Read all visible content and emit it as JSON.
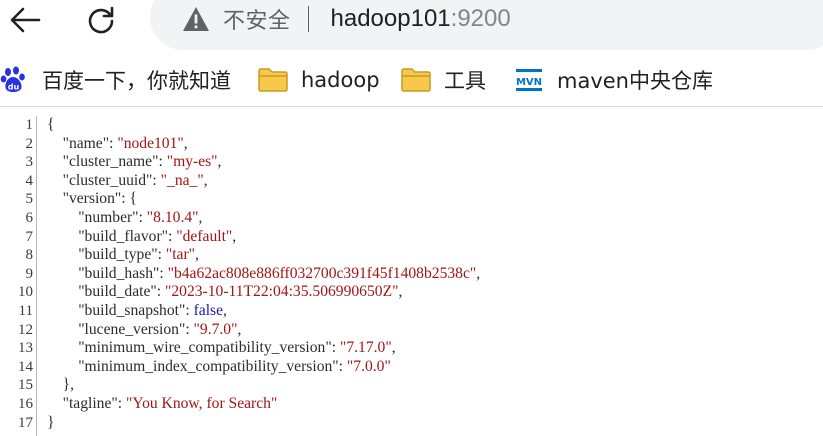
{
  "toolbar": {
    "security_label": "不安全",
    "url_host": "hadoop101",
    "url_port": ":9200"
  },
  "bookmarks": [
    {
      "label": "百度一下，你就知道",
      "icon": "baidu-paw-icon"
    },
    {
      "label": "hadoop",
      "icon": "folder-icon"
    },
    {
      "label": "工具",
      "icon": "folder-icon"
    },
    {
      "label": "maven中央仓库",
      "icon": "mvn-logo-icon"
    }
  ],
  "colors": {
    "folder": "#f6c84c",
    "baidu": "#2932e1",
    "maven_logo": "#0073c7",
    "string": "#a31515",
    "boolean": "#1a1aa6"
  },
  "json_lines": [
    {
      "n": "1",
      "parts": [
        [
          "p",
          "{"
        ]
      ]
    },
    {
      "n": "2",
      "parts": [
        [
          "p",
          "    "
        ],
        [
          "k",
          "\"name\""
        ],
        [
          "p",
          ": "
        ],
        [
          "s",
          "\"node101\""
        ],
        [
          "p",
          ","
        ]
      ]
    },
    {
      "n": "3",
      "parts": [
        [
          "p",
          "    "
        ],
        [
          "k",
          "\"cluster_name\""
        ],
        [
          "p",
          ": "
        ],
        [
          "s",
          "\"my-es\""
        ],
        [
          "p",
          ","
        ]
      ]
    },
    {
      "n": "4",
      "parts": [
        [
          "p",
          "    "
        ],
        [
          "k",
          "\"cluster_uuid\""
        ],
        [
          "p",
          ": "
        ],
        [
          "s",
          "\"_na_\""
        ],
        [
          "p",
          ","
        ]
      ]
    },
    {
      "n": "5",
      "parts": [
        [
          "p",
          "    "
        ],
        [
          "k",
          "\"version\""
        ],
        [
          "p",
          ": {"
        ]
      ]
    },
    {
      "n": "6",
      "parts": [
        [
          "p",
          "        "
        ],
        [
          "k",
          "\"number\""
        ],
        [
          "p",
          ": "
        ],
        [
          "s",
          "\"8.10.4\""
        ],
        [
          "p",
          ","
        ]
      ]
    },
    {
      "n": "7",
      "parts": [
        [
          "p",
          "        "
        ],
        [
          "k",
          "\"build_flavor\""
        ],
        [
          "p",
          ": "
        ],
        [
          "s",
          "\"default\""
        ],
        [
          "p",
          ","
        ]
      ]
    },
    {
      "n": "8",
      "parts": [
        [
          "p",
          "        "
        ],
        [
          "k",
          "\"build_type\""
        ],
        [
          "p",
          ": "
        ],
        [
          "s",
          "\"tar\""
        ],
        [
          "p",
          ","
        ]
      ]
    },
    {
      "n": "9",
      "parts": [
        [
          "p",
          "        "
        ],
        [
          "k",
          "\"build_hash\""
        ],
        [
          "p",
          ": "
        ],
        [
          "s",
          "\"b4a62ac808e886ff032700c391f45f1408b2538c\""
        ],
        [
          "p",
          ","
        ]
      ]
    },
    {
      "n": "10",
      "parts": [
        [
          "p",
          "        "
        ],
        [
          "k",
          "\"build_date\""
        ],
        [
          "p",
          ": "
        ],
        [
          "s",
          "\"2023-10-11T22:04:35.506990650Z\""
        ],
        [
          "p",
          ","
        ]
      ]
    },
    {
      "n": "11",
      "parts": [
        [
          "p",
          "        "
        ],
        [
          "k",
          "\"build_snapshot\""
        ],
        [
          "p",
          ": "
        ],
        [
          "b",
          "false"
        ],
        [
          "p",
          ","
        ]
      ]
    },
    {
      "n": "12",
      "parts": [
        [
          "p",
          "        "
        ],
        [
          "k",
          "\"lucene_version\""
        ],
        [
          "p",
          ": "
        ],
        [
          "s",
          "\"9.7.0\""
        ],
        [
          "p",
          ","
        ]
      ]
    },
    {
      "n": "13",
      "parts": [
        [
          "p",
          "        "
        ],
        [
          "k",
          "\"minimum_wire_compatibility_version\""
        ],
        [
          "p",
          ": "
        ],
        [
          "s",
          "\"7.17.0\""
        ],
        [
          "p",
          ","
        ]
      ]
    },
    {
      "n": "14",
      "parts": [
        [
          "p",
          "        "
        ],
        [
          "k",
          "\"minimum_index_compatibility_version\""
        ],
        [
          "p",
          ": "
        ],
        [
          "s",
          "\"7.0.0\""
        ]
      ]
    },
    {
      "n": "15",
      "parts": [
        [
          "p",
          "    },"
        ]
      ]
    },
    {
      "n": "16",
      "parts": [
        [
          "p",
          "    "
        ],
        [
          "k",
          "\"tagline\""
        ],
        [
          "p",
          ": "
        ],
        [
          "s",
          "\"You Know, for Search\""
        ]
      ]
    },
    {
      "n": "17",
      "parts": [
        [
          "p",
          "}"
        ]
      ]
    }
  ]
}
